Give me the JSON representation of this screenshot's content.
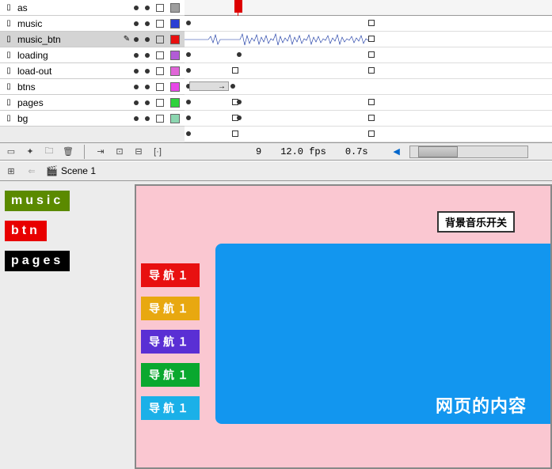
{
  "layers": [
    {
      "name": "as",
      "color": "#9e9e9e",
      "selected": false
    },
    {
      "name": "music",
      "color": "#2a3fd4",
      "selected": false
    },
    {
      "name": "music_btn",
      "color": "#e81010",
      "selected": true,
      "edit": true
    },
    {
      "name": "loading",
      "color": "#b25cd6",
      "selected": false
    },
    {
      "name": "load-out",
      "color": "#e065d8",
      "selected": false
    },
    {
      "name": "btns",
      "color": "#e847e8",
      "selected": false
    },
    {
      "name": "pages",
      "color": "#2ed23c",
      "selected": false
    },
    {
      "name": "bg",
      "color": "#8cd6b0",
      "selected": false
    }
  ],
  "status": {
    "frame": "9",
    "fps": "12.0 fps",
    "time": "0.7s"
  },
  "scene": {
    "label": "Scene 1"
  },
  "tags": [
    {
      "text": "music",
      "cls": "tag-green"
    },
    {
      "text": "btn",
      "cls": "tag-red"
    },
    {
      "text": "pages",
      "cls": "tag-black"
    }
  ],
  "stage": {
    "bgm_button": "背景音乐开关",
    "content_label": "网页的内容",
    "nav": [
      {
        "label": "导航１",
        "bg": "#e81010"
      },
      {
        "label": "导航１",
        "bg": "#e8a810"
      },
      {
        "label": "导航１",
        "bg": "#5a2fd4"
      },
      {
        "label": "导航１",
        "bg": "#0aa82f"
      },
      {
        "label": "导航１",
        "bg": "#1bb0e8"
      }
    ]
  }
}
